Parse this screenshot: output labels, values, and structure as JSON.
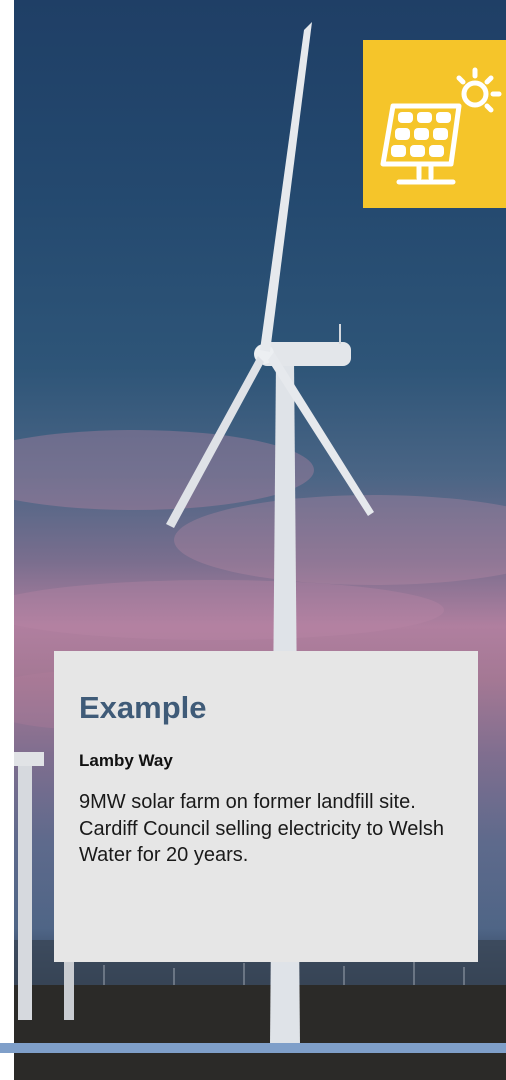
{
  "badge": {
    "icon": "solar-panel-icon",
    "color": "#f5c52a"
  },
  "example": {
    "heading": "Example",
    "subheading": "Lamby Way",
    "body": "9MW solar farm on former landfill site. Cardiff Council selling electricity to Welsh Water for 20 years.",
    "heading_color": "#3f5b78",
    "card_color": "#e6e6e6"
  },
  "accent_color": "#7f9fc9"
}
